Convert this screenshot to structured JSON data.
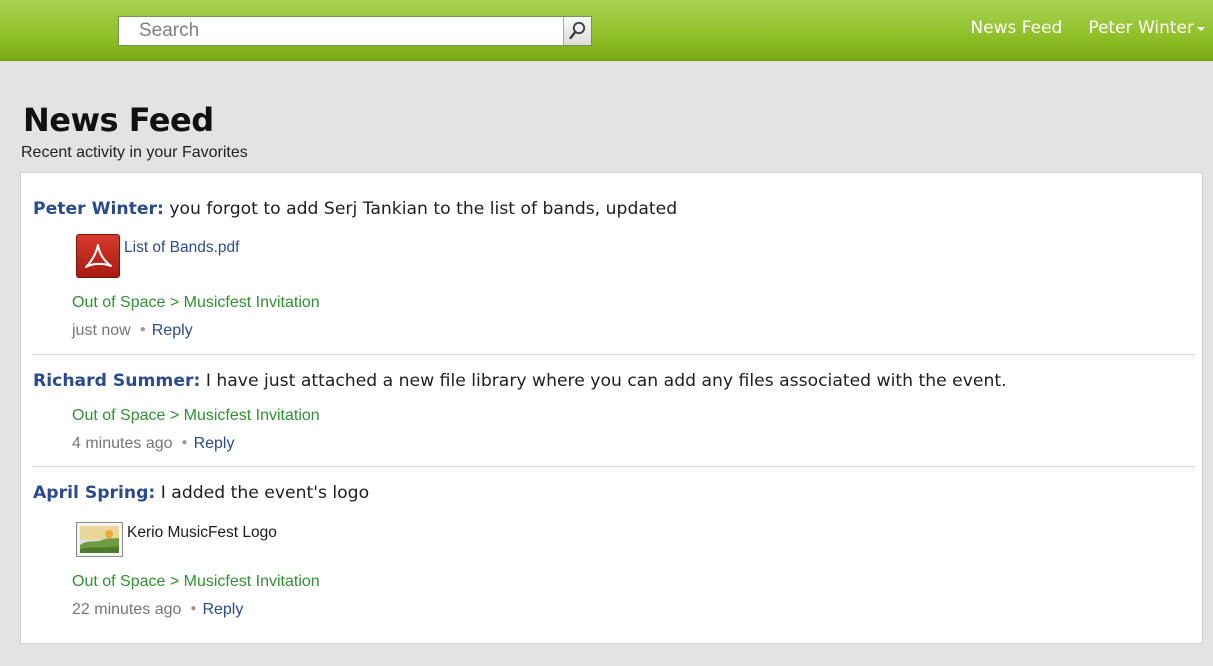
{
  "search": {
    "placeholder": "Search"
  },
  "topnav": {
    "news_feed": "News Feed",
    "user_name": "Peter Winter"
  },
  "page": {
    "title": "News Feed",
    "subtitle": "Recent activity in your Favorites"
  },
  "feed": [
    {
      "author": "Peter Winter:",
      "text": " you forgot to add Serj Tankian to the list of bands, updated",
      "attachment": {
        "name": "List of Bands.pdf",
        "icon": "pdf-icon"
      },
      "breadcrumb": "Out of Space > Musicfest Invitation",
      "time": "just now",
      "reply": "Reply"
    },
    {
      "author": "Richard Summer:",
      "text": " I have just attached a new file library where you can add any files associated with the event.",
      "breadcrumb": "Out of Space > Musicfest Invitation",
      "time": "4 minutes ago",
      "reply": "Reply"
    },
    {
      "author": "April Spring:",
      "text": " I added the event's logo",
      "attachment": {
        "name": "Kerio MusicFest Logo",
        "icon": "image-icon"
      },
      "breadcrumb": "Out of Space > Musicfest Invitation",
      "time": "22 minutes ago",
      "reply": "Reply"
    }
  ],
  "colors": {
    "topbar": "#92c22c",
    "link": "#2a4b8d",
    "breadcrumb": "#2e9230"
  }
}
